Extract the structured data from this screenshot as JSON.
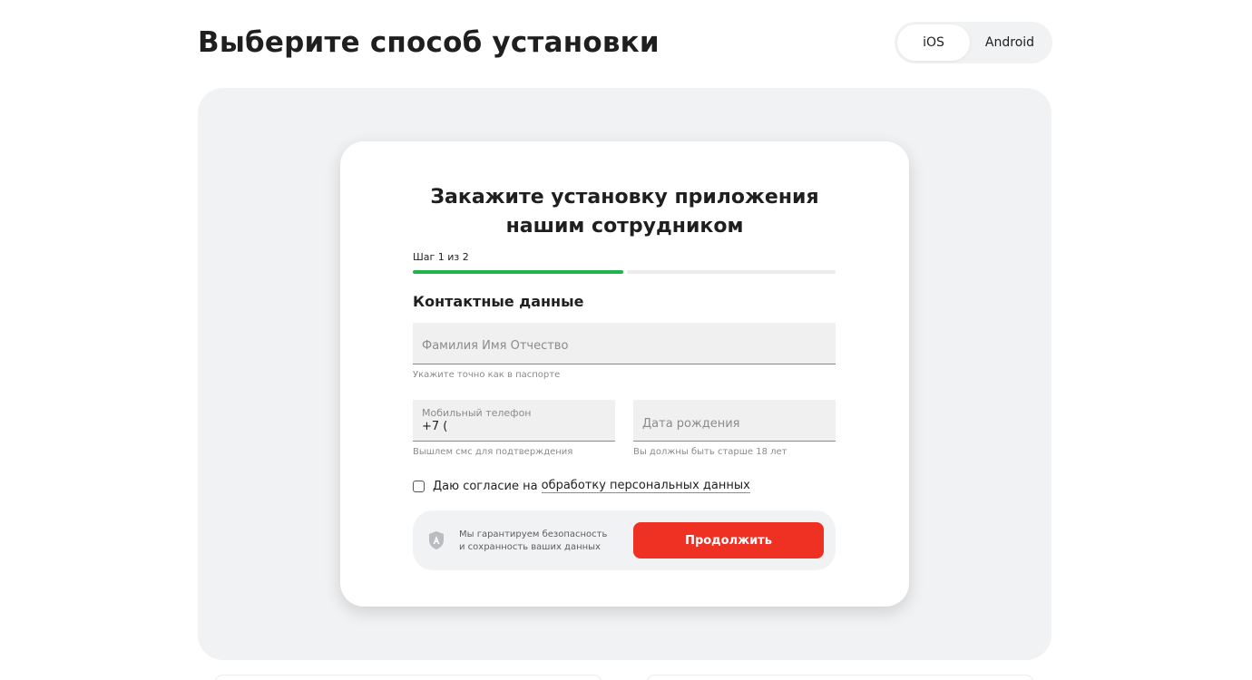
{
  "page": {
    "title": "Выберите способ установки"
  },
  "os_switch": {
    "tabs": [
      {
        "label": "iOS",
        "selected": true
      },
      {
        "label": "Android",
        "selected": false
      }
    ]
  },
  "card": {
    "title_line1": "Закажите установку приложения",
    "title_line2": "нашим сотрудником",
    "step_text": "Шаг 1 из 2",
    "progress": {
      "current_step": 1,
      "total_steps": 2,
      "active_color": "#21b24b"
    },
    "section_title": "Контактные данные",
    "fields": {
      "full_name": {
        "placeholder": "Фамилия Имя Отчество",
        "hint": "Укажите точно как в паспорте"
      },
      "phone": {
        "label": "Мобильный телефон",
        "value": "+7 (",
        "hint": "Вышлем смс для подтверждения"
      },
      "birth_date": {
        "placeholder": "Дата рождения",
        "hint": "Вы должны быть старше 18 лет"
      }
    },
    "consent": {
      "text": "Даю согласие на",
      "link": "обработку персональных данных",
      "checked": false
    },
    "security": {
      "icon": "shield-icon",
      "line1": "Мы гарантируем безопасность",
      "line2": "и сохранность ваших данных"
    },
    "continue_label": "Продолжить",
    "accent_color": "#ef3124"
  }
}
